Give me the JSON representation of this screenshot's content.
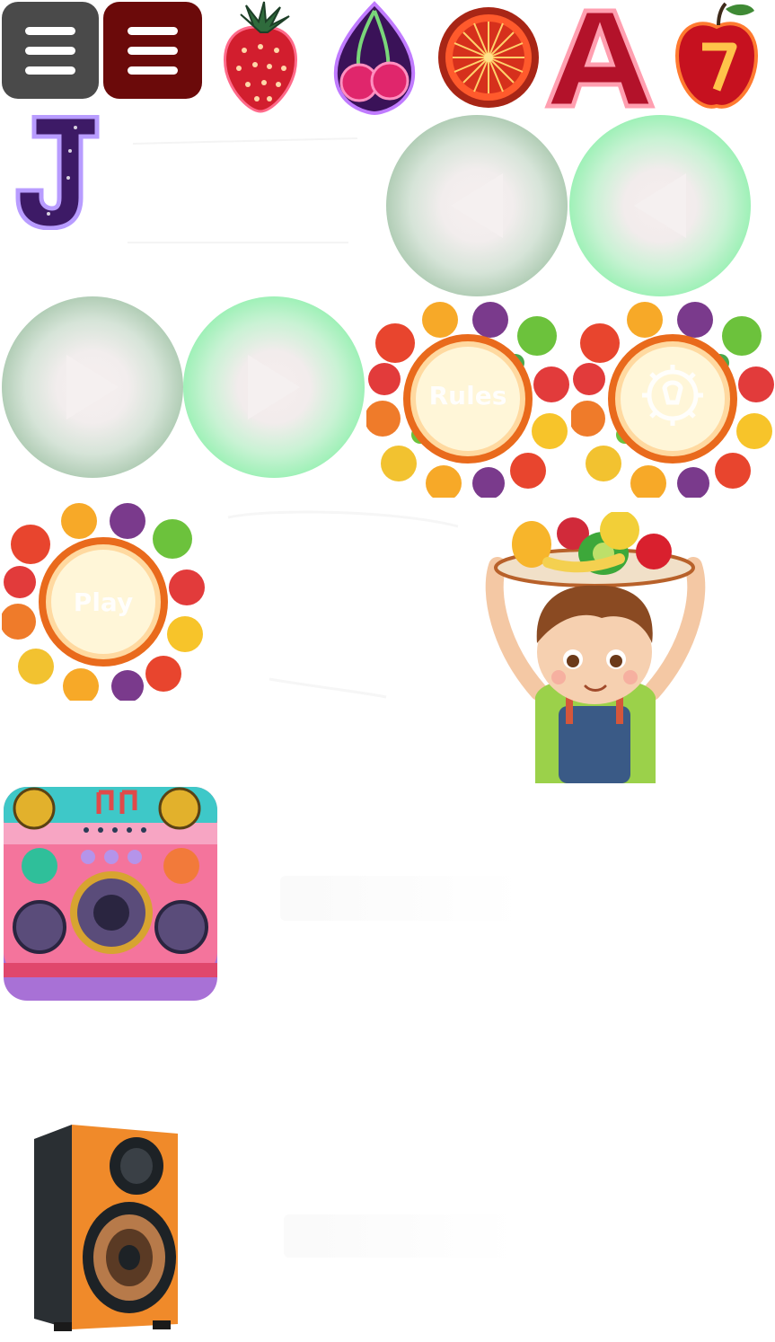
{
  "rules_label": "Rules",
  "play_label": "Play",
  "colors": {
    "menu_gray": "#4a4a4a",
    "menu_red": "#6b0a0a",
    "orb_gray_edge": "#7fa888",
    "orb_green_edge": "#5fe08a",
    "frame_orange": "#f28c2a",
    "frame_cream": "#fff6d8"
  },
  "icons": [
    "menu-icon",
    "strawberry-icon",
    "cherry-icon",
    "orange-slice-icon",
    "letter-a-icon",
    "apple-seven-icon",
    "letter-j-icon",
    "back-arrow-icon",
    "play-arrow-icon",
    "settings-gear-icon",
    "boy-fruit-tray-illustration",
    "radio-speaker-icon",
    "bookshelf-speaker-icon"
  ]
}
